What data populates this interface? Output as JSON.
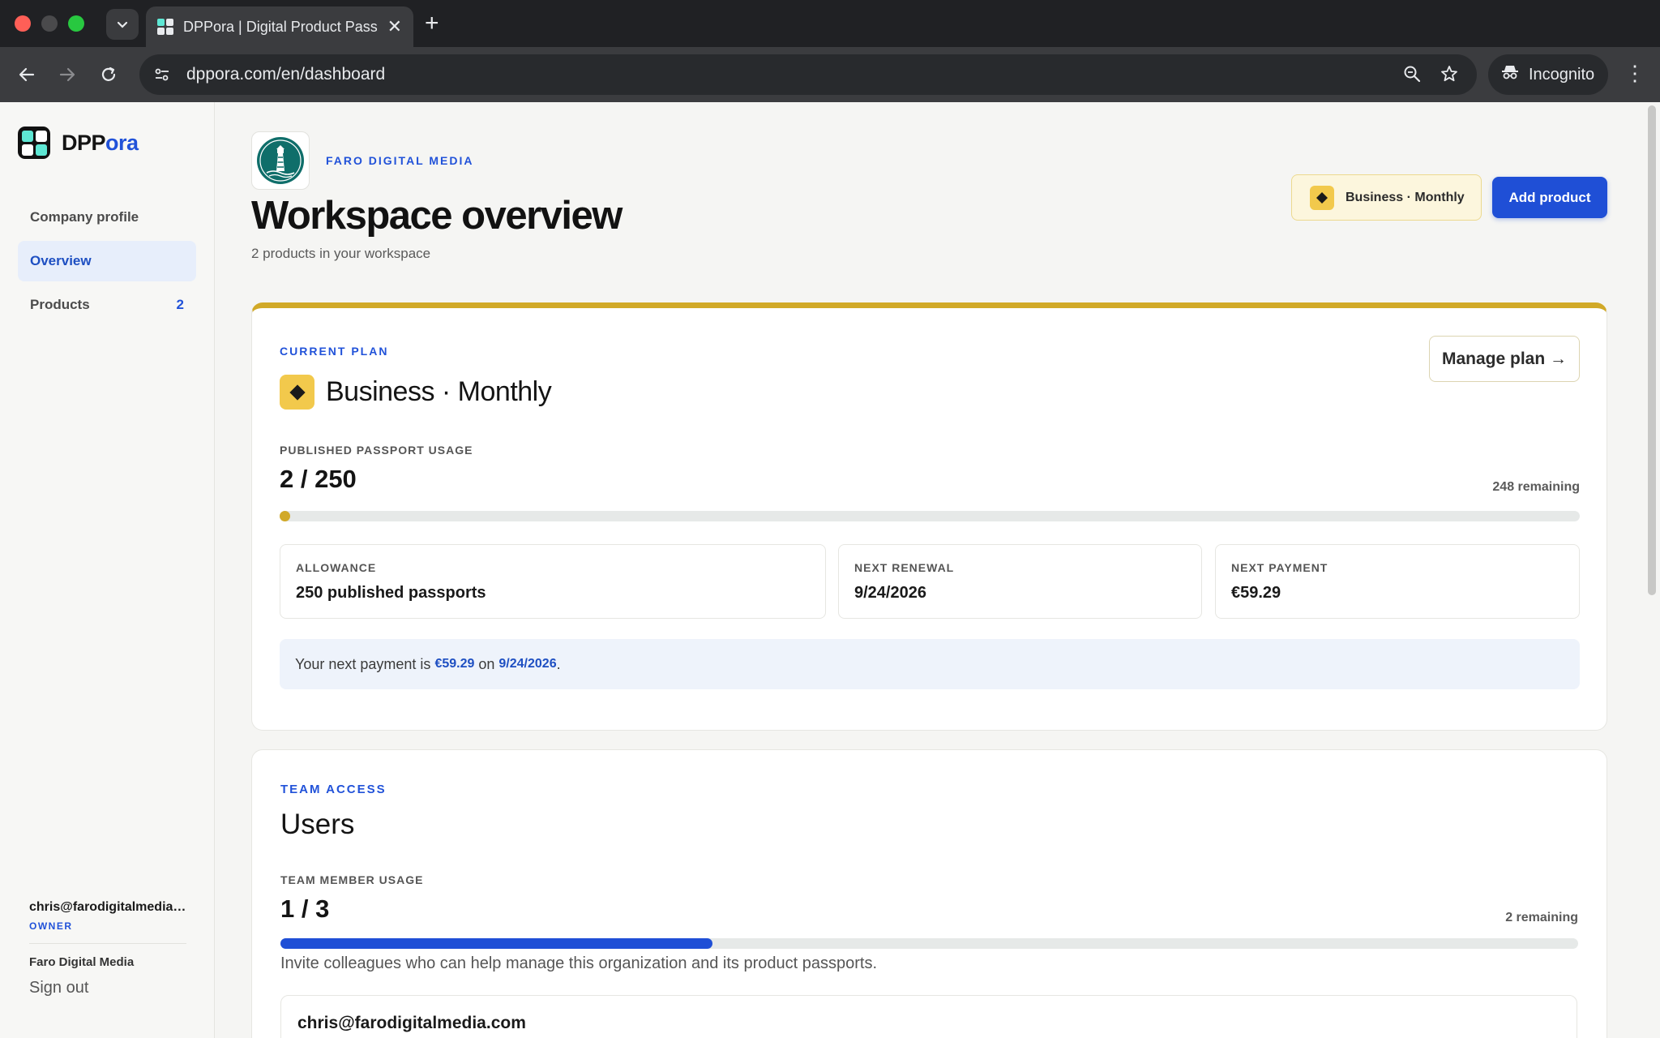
{
  "browser": {
    "tab_title": "DPPora | Digital Product Passport",
    "url": "dppora.com/en/dashboard",
    "incognito_label": "Incognito"
  },
  "sidebar": {
    "brand_prefix": "DPP",
    "brand_suffix": "ora",
    "items": [
      {
        "label": "Company profile",
        "count": ""
      },
      {
        "label": "Overview",
        "count": ""
      },
      {
        "label": "Products",
        "count": "2"
      }
    ],
    "user_email": "chris@farodigitalmedia.com",
    "user_role": "OWNER",
    "org_name": "Faro Digital Media",
    "signout_label": "Sign out"
  },
  "header": {
    "org_eyebrow": "FARO DIGITAL MEDIA",
    "title": "Workspace overview",
    "subtitle": "2 products in your workspace",
    "plan_pill": "Business · Monthly",
    "add_button": "Add product"
  },
  "plan_card": {
    "eyebrow": "CURRENT PLAN",
    "plan_name": "Business · Monthly",
    "manage_button": "Manage plan →",
    "usage_label": "PUBLISHED PASSPORT USAGE",
    "usage_value": "2 / 250",
    "usage_fraction": 0.008,
    "remaining": "248 remaining",
    "stats": [
      {
        "label": "ALLOWANCE",
        "value": "250 published passports"
      },
      {
        "label": "NEXT RENEWAL",
        "value": "9/24/2026"
      },
      {
        "label": "NEXT PAYMENT",
        "value": "€59.29"
      }
    ],
    "notice_prefix": "Your next payment is",
    "notice_amount": "€59.29",
    "notice_mid": "on",
    "notice_date": "9/24/2026",
    "notice_suffix": "."
  },
  "team_card": {
    "eyebrow": "TEAM ACCESS",
    "title": "Users",
    "usage_label": "TEAM MEMBER USAGE",
    "usage_value": "1 / 3",
    "usage_fraction": 0.333,
    "remaining": "2 remaining",
    "invite_text": "Invite colleagues who can help manage this organization and its product passports.",
    "members": [
      {
        "email": "chris@farodigitalmedia.com"
      }
    ]
  },
  "colors": {
    "accent_blue": "#1f4fd6",
    "gold": "#d1a928",
    "pill_yellow": "#f2c94c"
  },
  "icons": [
    "sidebar-toggle-icon",
    "back-arrow-icon",
    "forward-arrow-icon",
    "reload-icon",
    "site-settings-icon",
    "zoom-icon",
    "star-icon",
    "incognito-icon",
    "more-vert-icon",
    "diamond-icon",
    "lighthouse-logo-icon"
  ]
}
